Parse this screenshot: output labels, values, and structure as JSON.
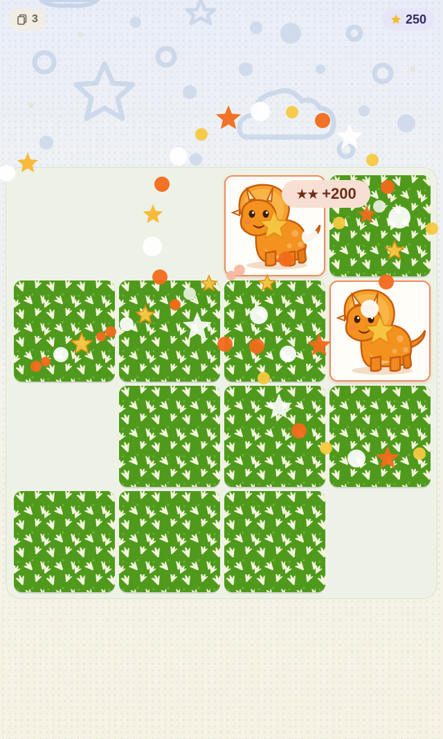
{
  "hud": {
    "cards_icon": "cards-icon",
    "cards_count": "3",
    "score_icon": "star-icon",
    "score": "250"
  },
  "board": {
    "rows": 4,
    "cols": 4,
    "tiles": [
      {
        "state": "empty"
      },
      {
        "state": "empty"
      },
      {
        "state": "face",
        "creature": "triceratops"
      },
      {
        "state": "back"
      },
      {
        "state": "back"
      },
      {
        "state": "back"
      },
      {
        "state": "back"
      },
      {
        "state": "face",
        "creature": "triceratops"
      },
      {
        "state": "empty"
      },
      {
        "state": "back"
      },
      {
        "state": "back"
      },
      {
        "state": "back"
      },
      {
        "state": "back"
      },
      {
        "state": "back"
      },
      {
        "state": "back"
      },
      {
        "state": "empty"
      }
    ]
  },
  "match_popup": {
    "stars": "★★",
    "points": "+200"
  },
  "colors": {
    "tile_back": "#4f9a1c",
    "footprint": "#f3f4dc",
    "face_border": "#ee8a5d",
    "accent_orange": "#f26a1b",
    "accent_gold": "#f7b731",
    "score_text": "#2c2c63"
  }
}
